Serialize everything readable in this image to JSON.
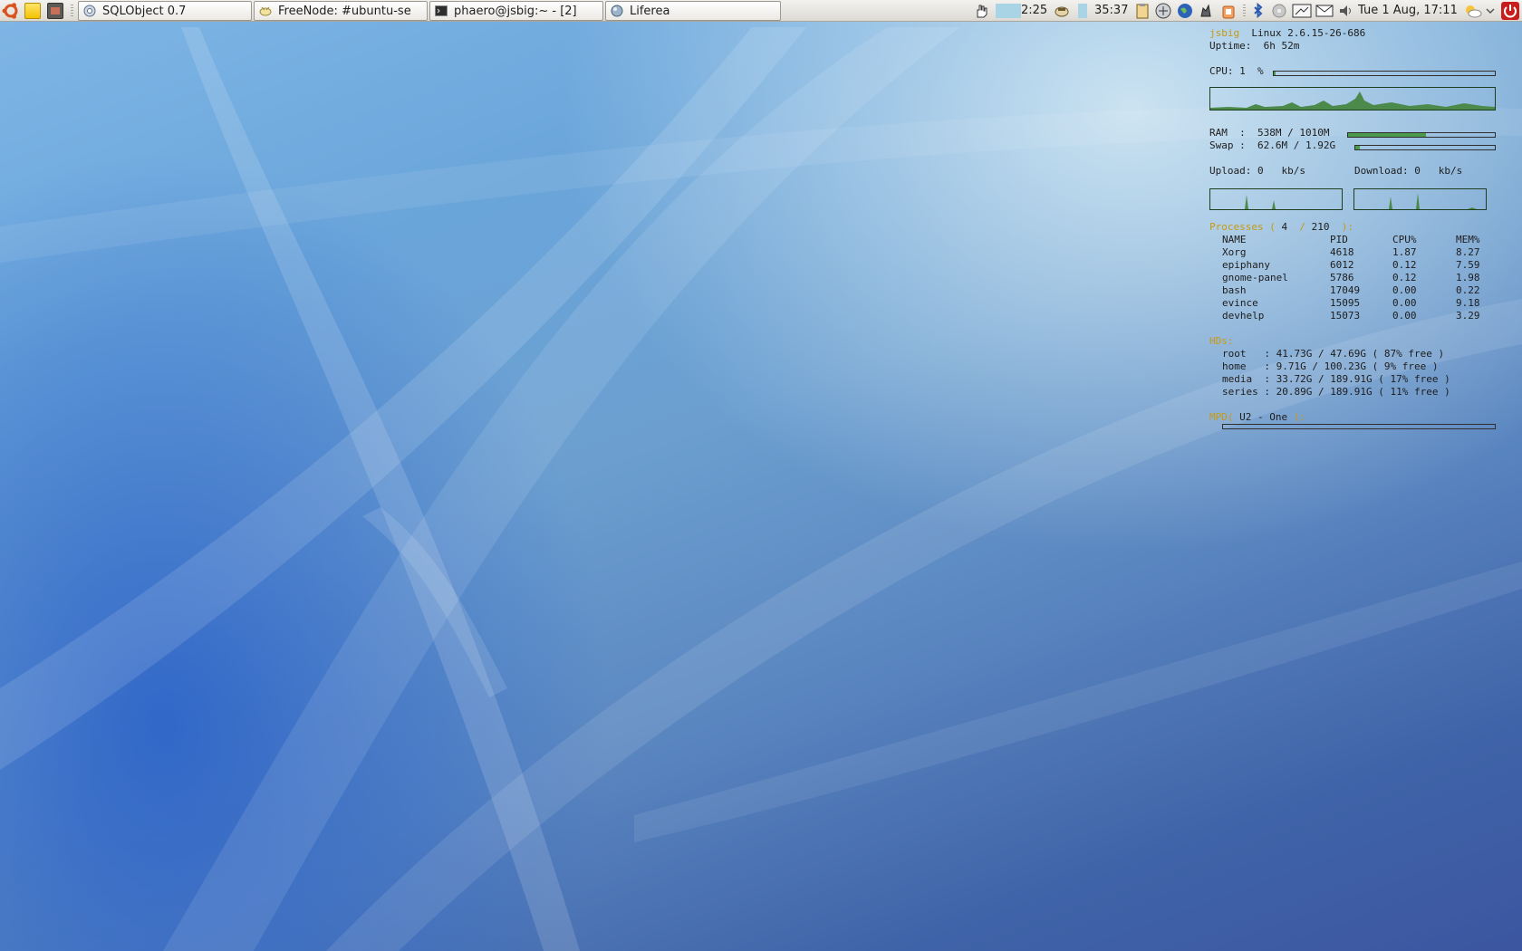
{
  "taskbar": {
    "launchers": [
      {
        "icon": "ubuntu-logo-icon"
      },
      {
        "icon": "notes-icon"
      },
      {
        "icon": "screenshot-icon"
      }
    ],
    "tasks": [
      {
        "label": "SQLObject 0.7",
        "icon": "epiphany-icon"
      },
      {
        "label": "FreeNode: #ubuntu-se",
        "icon": "xchat-icon"
      },
      {
        "label": "phaero@jsbig:~ - [2]",
        "icon": "terminal-icon"
      },
      {
        "label": "Liferea",
        "icon": "liferea-icon"
      }
    ]
  },
  "tray": {
    "timer_left": "2:25",
    "timer_right": "35:37",
    "clock": "Tue  1 Aug, 17:11",
    "icons": [
      "hand-icon",
      "phone-icon",
      "clipboard-icon",
      "network-icon",
      "globe-icon",
      "weather-icon",
      "trash-icon",
      "bluetooth-icon",
      "disc-icon",
      "display-icon",
      "mail-icon",
      "volume-icon",
      "weather-clouds-icon",
      "chevron-down-icon",
      "quit-icon"
    ]
  },
  "conky": {
    "host": "jsbig",
    "kernel": "Linux 2.6.15-26-686",
    "uptime_label": "Uptime:",
    "uptime": "6h 52m",
    "cpu_label": "CPU:",
    "cpu_value": "1  %",
    "cpu_percent": 1,
    "ram_label": "RAM  :",
    "ram_value": "538M / 1010M",
    "ram_fraction": 0.53,
    "swap_label": "Swap :",
    "swap_value": "62.6M / 1.92G",
    "swap_fraction": 0.03,
    "upload_label": "Upload:",
    "upload_value": "0",
    "upload_unit": "kb/s",
    "download_label": "Download:",
    "download_value": "0",
    "download_unit": "kb/s",
    "processes_label": "Processes",
    "processes_running": "4",
    "processes_total": "210",
    "process_headers": [
      "NAME",
      "PID",
      "CPU%",
      "MEM%"
    ],
    "processes": [
      [
        "Xorg",
        "4618",
        "1.87",
        "8.27"
      ],
      [
        "epiphany",
        "6012",
        "0.12",
        "7.59"
      ],
      [
        "gnome-panel",
        "5786",
        "0.12",
        "1.98"
      ],
      [
        "bash",
        "17049",
        "0.00",
        "0.22"
      ],
      [
        "evince",
        "15095",
        "0.00",
        "9.18"
      ],
      [
        "devhelp",
        "15073",
        "0.00",
        "3.29"
      ]
    ],
    "hds_label": "HDs:",
    "hds": [
      {
        "name": "root  ",
        "used": "41.73G",
        "total": "47.69G",
        "free": "87% free"
      },
      {
        "name": "home  ",
        "used": "9.71G",
        "total": "100.23G",
        "free": "9% free"
      },
      {
        "name": "media ",
        "used": "33.72G",
        "total": "189.91G",
        "free": "17% free"
      },
      {
        "name": "series",
        "used": "20.89G",
        "total": "189.91G",
        "free": "11% free"
      }
    ],
    "mpd_label": "MPD(",
    "mpd_track": "U2 - One",
    "mpd_close": "):",
    "mpd_progress": 0
  },
  "colors": {
    "conky_accent": "#c89a10",
    "conky_bar": "#4c9a4c",
    "panel_bg": "#e8e6e1"
  }
}
